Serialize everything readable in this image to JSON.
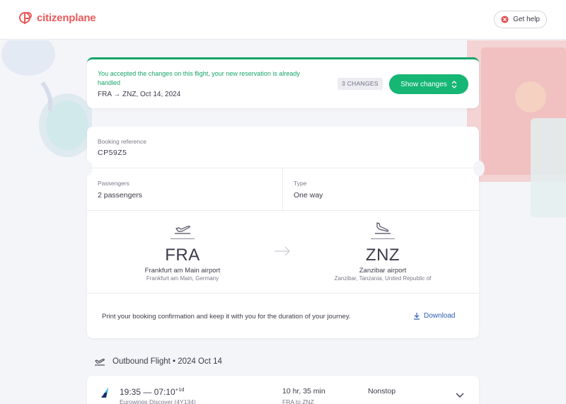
{
  "header": {
    "logo_text": "citizenplane",
    "help_label": "Get help"
  },
  "notice": {
    "message": "You accepted the changes on this flight, your new reservation is already handled",
    "route": "FRA → ZNZ, Oct 14, 2024",
    "changes_badge": "3 CHANGES",
    "show_changes_label": "Show changes"
  },
  "booking": {
    "reference_label": "Booking reference",
    "reference_value": "CP59Z5",
    "passengers_label": "Passengers",
    "passengers_value": "2 passengers",
    "type_label": "Type",
    "type_value": "One way",
    "origin": {
      "code": "FRA",
      "airport": "Frankfurt am Main airport",
      "city": "Frankfurt am Main, Germany"
    },
    "destination": {
      "code": "ZNZ",
      "airport": "Zanzibar airport",
      "city": "Zanzibar, Tanzania, United Republic of"
    },
    "print_text": "Print your booking confirmation and keep it with you for the duration of your journey.",
    "download_label": "Download"
  },
  "outbound": {
    "title": "Outbound Flight • 2024 Oct 14",
    "times": "19:35 — 07:10",
    "day_offset": "+1d",
    "carrier": "Eurowings Discover (4Y134)",
    "duration": "10 hr, 35 min",
    "route": "FRA to ZNZ",
    "stops": "Nonstop"
  },
  "colors": {
    "brand": "#ea5a5a",
    "accent_green": "#16b675",
    "link_blue": "#2a5db0"
  }
}
